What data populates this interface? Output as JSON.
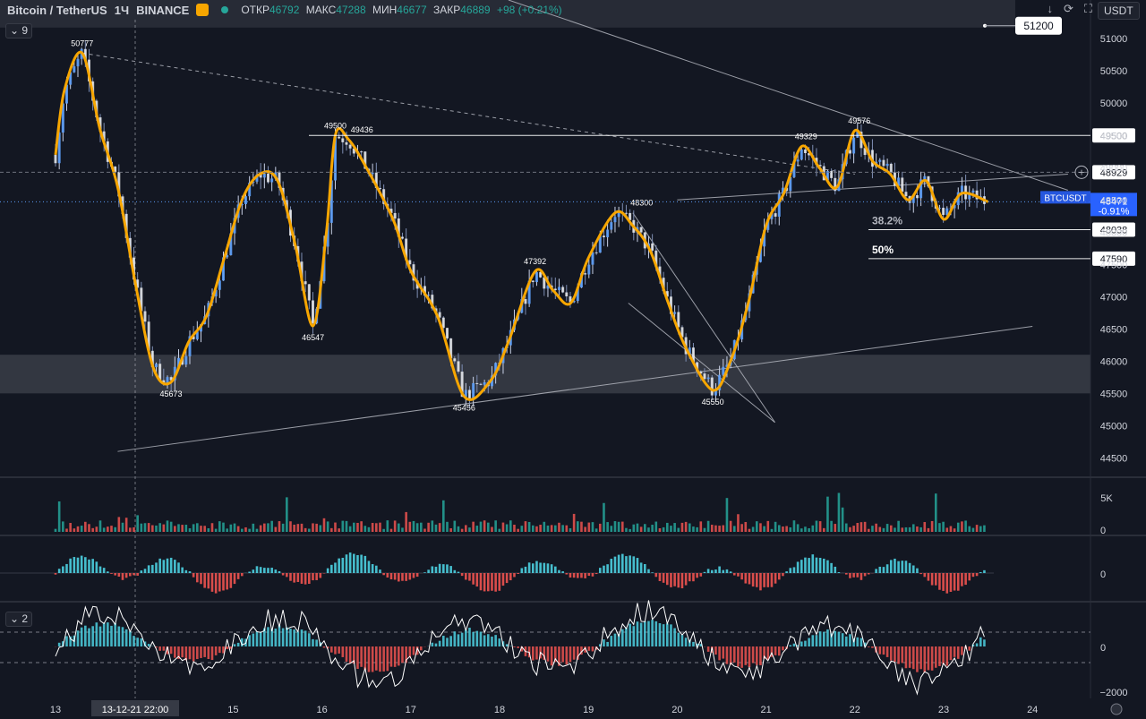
{
  "header": {
    "symbol": "Bitcoin / TetherUS",
    "timeframe": "1Ч",
    "exchange": "BINANCE",
    "open_label": "ОТКР",
    "open": "46792",
    "high_label": "МАКС",
    "high": "47288",
    "low_label": "МИН",
    "low": "46677",
    "close_label": "ЗАКР",
    "close": "46889",
    "change": "+98 (+0.21%)",
    "currency": "USDT",
    "indicator_count": "9",
    "oscillator_count": "2"
  },
  "colors": {
    "background": "#131722",
    "up": "#5b9cf6",
    "down": "#ef5350",
    "orange_wave": "#f7a600",
    "line": "#b2b5be",
    "accent_blue": "#2962ff",
    "volume_up": "#26a69a",
    "volume_down": "#ef5350"
  },
  "chart_data": {
    "type": "line",
    "title": "Bitcoin / TetherUS",
    "x_ticks": [
      "13",
      "13-12-21  22:00",
      "15",
      "16",
      "17",
      "18",
      "19",
      "20",
      "21",
      "22",
      "23",
      "24"
    ],
    "y_ticks": [
      51000,
      50500,
      50000,
      49500,
      49000,
      48500,
      48000,
      47500,
      47000,
      46500,
      46000,
      45500,
      45000,
      44500
    ],
    "ylim": [
      44200,
      51600
    ],
    "price_path": [
      [
        13.0,
        49200
      ],
      [
        13.1,
        50200
      ],
      [
        13.3,
        50777
      ],
      [
        13.5,
        49600
      ],
      [
        13.7,
        48700
      ],
      [
        13.9,
        47200
      ],
      [
        14.1,
        45900
      ],
      [
        14.3,
        45673
      ],
      [
        14.5,
        46300
      ],
      [
        14.7,
        46700
      ],
      [
        14.9,
        47600
      ],
      [
        15.1,
        48500
      ],
      [
        15.3,
        48900
      ],
      [
        15.5,
        48800
      ],
      [
        15.7,
        47800
      ],
      [
        15.9,
        46547
      ],
      [
        16.05,
        48000
      ],
      [
        16.15,
        49500
      ],
      [
        16.3,
        49436
      ],
      [
        16.5,
        49000
      ],
      [
        16.8,
        48200
      ],
      [
        17.0,
        47400
      ],
      [
        17.3,
        46700
      ],
      [
        17.6,
        45456
      ],
      [
        17.9,
        45700
      ],
      [
        18.1,
        46300
      ],
      [
        18.4,
        47392
      ],
      [
        18.6,
        47100
      ],
      [
        18.8,
        46900
      ],
      [
        19.0,
        47600
      ],
      [
        19.3,
        48300
      ],
      [
        19.5,
        48100
      ],
      [
        19.7,
        47700
      ],
      [
        19.9,
        46900
      ],
      [
        20.1,
        46200
      ],
      [
        20.4,
        45550
      ],
      [
        20.6,
        46000
      ],
      [
        20.8,
        46900
      ],
      [
        21.0,
        48100
      ],
      [
        21.2,
        48600
      ],
      [
        21.4,
        49329
      ],
      [
        21.6,
        49000
      ],
      [
        21.8,
        48700
      ],
      [
        22.0,
        49576
      ],
      [
        22.2,
        49100
      ],
      [
        22.4,
        48900
      ],
      [
        22.6,
        48500
      ],
      [
        22.8,
        48800
      ],
      [
        23.0,
        48200
      ],
      [
        23.2,
        48600
      ],
      [
        23.5,
        48471
      ]
    ],
    "swing_labels": [
      {
        "x": 13.3,
        "value": "50777"
      },
      {
        "x": 14.3,
        "value": "45673"
      },
      {
        "x": 16.15,
        "value": "49500"
      },
      {
        "x": 16.45,
        "value": "49436"
      },
      {
        "x": 15.9,
        "value": "46547"
      },
      {
        "x": 17.6,
        "value": "45456"
      },
      {
        "x": 18.4,
        "value": "47392"
      },
      {
        "x": 19.6,
        "value": "48300"
      },
      {
        "x": 20.4,
        "value": "45550"
      },
      {
        "x": 21.45,
        "value": "49329"
      },
      {
        "x": 22.05,
        "value": "49576"
      }
    ],
    "levels": [
      {
        "value": 51200,
        "label": "51200"
      },
      {
        "value": 49500,
        "label": "49500"
      },
      {
        "value": 48929,
        "label": "48929"
      },
      {
        "value": 48471,
        "label": "48471",
        "symbol": "BTCUSDT",
        "change": "-0.91%"
      },
      {
        "value": 48038,
        "label": "48038",
        "fib": "38.2%"
      },
      {
        "value": 47590,
        "label": "47590",
        "fib": "50%"
      }
    ],
    "support_zone": [
      45500,
      46100
    ],
    "top_zone": [
      51200,
      51600
    ],
    "volume_axis": [
      "5K",
      "0"
    ],
    "macd_axis": [
      "0"
    ],
    "osc_axis": [
      "0",
      "−2000"
    ]
  }
}
